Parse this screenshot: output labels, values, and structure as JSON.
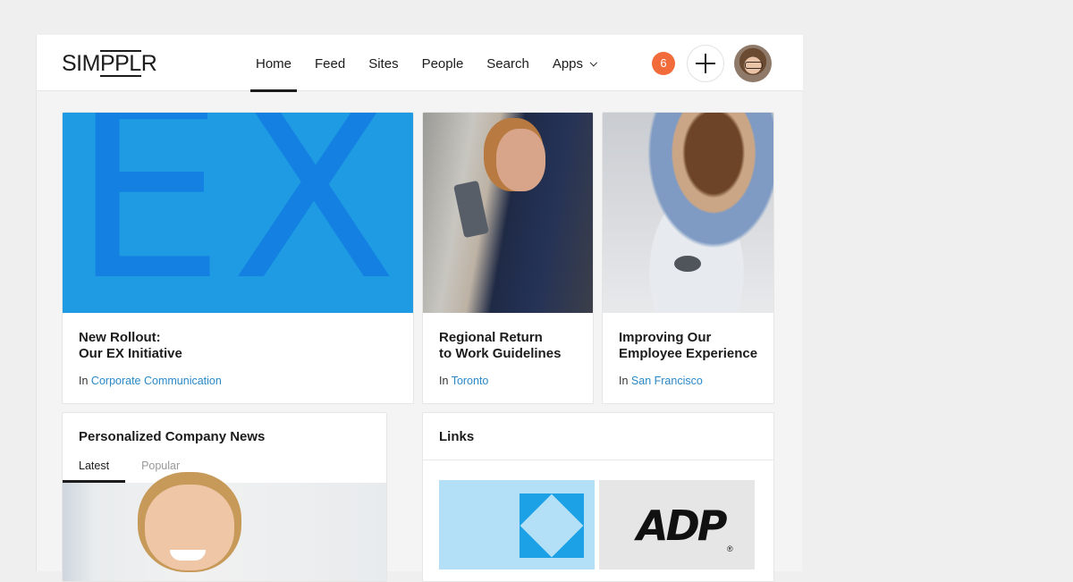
{
  "header": {
    "logo": {
      "prefix": "SIM",
      "middle": "PPL",
      "suffix": "R"
    },
    "nav": [
      {
        "label": "Home",
        "active": true
      },
      {
        "label": "Feed",
        "active": false
      },
      {
        "label": "Sites",
        "active": false
      },
      {
        "label": "People",
        "active": false
      },
      {
        "label": "Search",
        "active": false
      },
      {
        "label": "Apps",
        "active": false,
        "dropdown": true
      }
    ],
    "notification_count": "6",
    "notification_color": "#f26b3a",
    "add_icon": "plus-icon",
    "avatar_icon": "user-avatar"
  },
  "featured": [
    {
      "image": "EX",
      "title": "New Rollout:\nOur EX Initiative",
      "prefix": "In",
      "site": "Corporate Communication"
    },
    {
      "image": "woman-with-tablet-photo",
      "title": "Regional Return\nto Work Guidelines",
      "prefix": "In",
      "site": "Toronto"
    },
    {
      "image": "coffee-cup-photo",
      "title": "Improving Our\nEmployee Experience",
      "prefix": "In",
      "site": "San Francisco"
    }
  ],
  "news": {
    "title": "Personalized Company News",
    "tabs": [
      {
        "label": "Latest",
        "active": true
      },
      {
        "label": "Popular",
        "active": false
      }
    ],
    "image": "smiling-woman-photo"
  },
  "links": {
    "title": "Links",
    "tiles": [
      {
        "name": "blue-diamond-logo"
      },
      {
        "name": "ADP",
        "label": "ADP",
        "mark": "®"
      }
    ]
  },
  "colors": {
    "accent_link": "#2b88c6",
    "ex_bg": "#1e9be3",
    "ex_fg": "#1380e2"
  }
}
